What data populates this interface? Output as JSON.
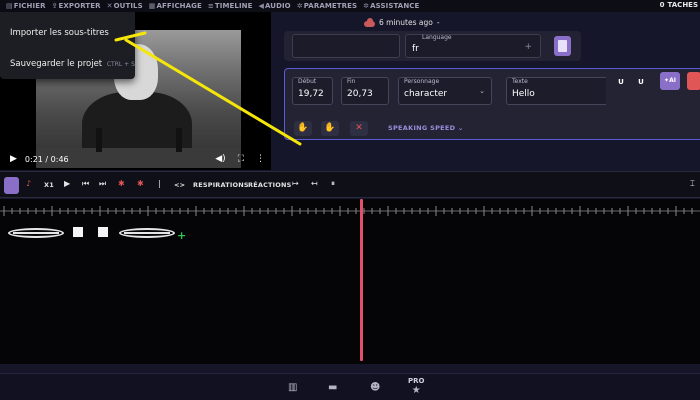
{
  "menu": {
    "items": [
      {
        "icon": "file-icon",
        "glyph": "▤",
        "label": "FICHIER"
      },
      {
        "icon": "export-icon",
        "glyph": "⇪",
        "label": "EXPORTER"
      },
      {
        "icon": "tools-icon",
        "glyph": "✕",
        "label": "OUTILS"
      },
      {
        "icon": "display-icon",
        "glyph": "▦",
        "label": "AFFICHAGE"
      },
      {
        "icon": "timeline-icon",
        "glyph": "≡",
        "label": "TIMELINE"
      },
      {
        "icon": "audio-icon",
        "glyph": "◀",
        "label": "AUDIO"
      },
      {
        "icon": "settings-icon",
        "glyph": "✲",
        "label": "PARAMETRES"
      },
      {
        "icon": "assistance-icon",
        "glyph": "✲",
        "label": "ASSISTANCE"
      }
    ],
    "tasks_count": "0",
    "tasks_label": "TACHES"
  },
  "save_status": "6 minutes ago",
  "save_status_suffix": "-",
  "file_menu": {
    "import_subtitles": "Importer les sous-titres",
    "save_project": "Sauvegarder le projet",
    "save_shortcut": "CTRL + S"
  },
  "video": {
    "time": "0:21 / 0:46"
  },
  "language": {
    "label": "Language",
    "value": "fr",
    "add": "+"
  },
  "editor": {
    "start_label": "Début",
    "start_value": "19,72",
    "end_label": "Fin",
    "end_value": "20,73",
    "character_label": "Personnage",
    "character_value": "character",
    "text_label": "Texte",
    "text_value": "Hello",
    "underline_1": "U",
    "underline_2": "U",
    "speaking_speed": "SPEAKING SPEED",
    "speed_chevron": "⌄"
  },
  "toolbar": {
    "speed": "X1",
    "breaths": "RESPIRATIONS",
    "reactions": "RÉACTIONS",
    "code": "<>"
  },
  "bottom_nav": {
    "pro_label": "PRO"
  },
  "colors": {
    "accent": "#8a6fc9",
    "playhead": "#e2506a",
    "highlight_border": "#5b5bd4",
    "annotation": "#f5e60a",
    "add_green": "#2ec44d"
  }
}
